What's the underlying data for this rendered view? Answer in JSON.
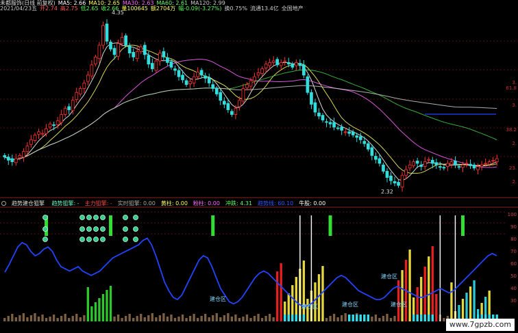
{
  "header": {
    "line1": [
      {
        "text": "未都服饰(日线 前复权)",
        "color": "#dddddd"
      },
      {
        "text": "MA5: 2.66",
        "color": "#ffffff"
      },
      {
        "text": "MA10: 2.65",
        "color": "#ffff66"
      },
      {
        "text": "MA30: 2.63",
        "color": "#ff66ff"
      },
      {
        "text": "MA60: 2.61",
        "color": "#66ff66"
      },
      {
        "text": "MA120: 2.99",
        "color": "#cccccc"
      }
    ],
    "line2": [
      {
        "text": "2021/04/23五",
        "color": "#cccccc"
      },
      {
        "text": "开2.74",
        "color": "#ff5555"
      },
      {
        "text": "高2.75",
        "color": "#ff5555"
      },
      {
        "text": "低2.65",
        "color": "#55ff55"
      },
      {
        "text": "收2.66",
        "color": "#55ff55"
      },
      {
        "text": "量100645",
        "color": "#ffff66"
      },
      {
        "text": "额2704万",
        "color": "#ffff66"
      },
      {
        "text": "幅-0.09(-3.27%)",
        "color": "#55ff55"
      },
      {
        "text": "换0.75%",
        "color": "#cccccc"
      },
      {
        "text": "流通13.4亿",
        "color": "#cccccc"
      },
      {
        "text": "全国地产",
        "color": "#cccccc"
      }
    ]
  },
  "price_axis": {
    "ticks": [
      "3.",
      "61.8",
      "3.",
      "38.2",
      "2.",
      "23.",
      "2."
    ]
  },
  "annotations": {
    "high": "4.35",
    "low": "2.32"
  },
  "indicator_header": {
    "title": "趋势建仓狙擎",
    "items": [
      {
        "text": "趋势狙擎: -",
        "color": "#66ffcc"
      },
      {
        "text": "主力狙擎: -",
        "color": "#ff4444"
      },
      {
        "text": "实时狙擎: 0.00",
        "color": "#aaaaaa"
      },
      {
        "text": "黄柱: 0.00",
        "color": "#ffff66"
      },
      {
        "text": "粉柱: 0.00",
        "color": "#ff66ff"
      },
      {
        "text": "冲跌: 4.31",
        "color": "#66ff66"
      },
      {
        "text": "趋势线: 60.10",
        "color": "#3355ff"
      },
      {
        "text": "牛股: 0.00",
        "color": "#ffffff"
      }
    ]
  },
  "indicator_axis": {
    "ticks": [
      "100",
      "90",
      "80",
      "70",
      "60",
      "50",
      "40",
      "30"
    ]
  },
  "indicator_labels": [
    "建仓区",
    "建仓区",
    "建仓区",
    "建仓区",
    "建仓区"
  ],
  "watermark": "www.7gpzb.com",
  "colors": {
    "up": "#ff3333",
    "down": "#33dddd",
    "ma5": "#ffffff",
    "ma10": "#ffff66",
    "ma30": "#ff66ff",
    "ma60": "#44cc44",
    "ma120": "#cccccc",
    "trend": "#2244ff",
    "green_bar": "#33dd33",
    "yellow_bar": "#ffee44",
    "red_bar": "#ff2222",
    "cyan_bar": "#33ddee"
  },
  "chart_data": [
    {
      "type": "candlestick",
      "title": "未都服饰(日线 前复权)",
      "ylim": [
        2.2,
        4.5
      ],
      "closes": [
        2.68,
        2.64,
        2.62,
        2.66,
        2.7,
        2.75,
        2.82,
        2.9,
        2.96,
        3.0,
        2.98,
        3.04,
        3.1,
        3.08,
        3.14,
        3.22,
        3.3,
        3.28,
        3.4,
        3.5,
        3.55,
        3.62,
        3.72,
        3.85,
        3.95,
        4.1,
        4.35,
        4.15,
        4.05,
        3.98,
        4.12,
        4.2,
        4.1,
        4.0,
        3.95,
        4.02,
        4.08,
        3.98,
        3.86,
        3.8,
        3.9,
        4.0,
        3.95,
        3.88,
        3.82,
        3.78,
        3.7,
        3.66,
        3.6,
        3.64,
        3.7,
        3.76,
        3.72,
        3.68,
        3.62,
        3.55,
        3.48,
        3.4,
        3.35,
        3.28,
        3.22,
        3.3,
        3.4,
        3.55,
        3.6,
        3.65,
        3.7,
        3.75,
        3.8,
        3.86,
        3.88,
        3.9,
        3.85,
        3.88,
        3.9,
        3.86,
        3.82,
        3.88,
        3.84,
        3.72,
        3.5,
        3.35,
        3.25,
        3.2,
        3.15,
        3.12,
        3.1,
        3.06,
        3.05,
        3.02,
        3.0,
        2.98,
        2.96,
        2.93,
        2.9,
        2.85,
        2.78,
        2.7,
        2.65,
        2.6,
        2.5,
        2.42,
        2.38,
        2.35,
        2.32,
        2.45,
        2.52,
        2.58,
        2.62,
        2.6,
        2.56,
        2.62,
        2.65,
        2.6,
        2.58,
        2.55,
        2.54,
        2.6,
        2.62,
        2.58,
        2.55,
        2.58,
        2.6,
        2.57,
        2.54,
        2.56,
        2.58,
        2.6,
        2.62,
        2.64,
        2.66
      ],
      "series": [
        {
          "name": "MA5",
          "last": 2.66
        },
        {
          "name": "MA10",
          "last": 2.65
        },
        {
          "name": "MA30",
          "last": 2.63
        },
        {
          "name": "MA60",
          "last": 2.61
        },
        {
          "name": "MA120",
          "last": 2.99
        }
      ]
    },
    {
      "type": "bar",
      "title": "趋势建仓狙擎",
      "ylim": [
        0,
        100
      ],
      "trend_line": [
        45,
        52,
        60,
        68,
        72,
        70,
        64,
        60,
        62,
        66,
        68,
        64,
        56,
        50,
        48,
        46,
        48,
        50,
        46,
        44,
        42,
        44,
        46,
        50,
        54,
        58,
        60,
        62,
        64,
        66,
        68,
        70,
        74,
        76,
        70,
        60,
        48,
        36,
        28,
        22,
        20,
        24,
        32,
        40,
        48,
        56,
        60,
        58,
        50,
        40,
        30,
        24,
        18,
        16,
        18,
        22,
        28,
        34,
        40,
        44,
        46,
        44,
        40,
        36,
        32,
        28,
        24,
        20,
        16,
        14,
        14,
        16,
        20,
        24,
        28,
        32,
        36,
        40,
        42,
        40,
        36,
        32,
        28,
        26,
        24,
        22,
        20,
        20,
        22,
        26,
        30,
        32,
        30,
        28,
        26,
        24,
        22,
        22,
        24,
        26,
        28,
        30,
        28,
        26,
        28,
        32,
        36,
        40,
        44,
        48,
        52,
        56,
        60,
        62,
        60
      ],
      "green_signal_columns": [
        11,
        28,
        55,
        86,
        121,
        150
      ],
      "tall_columns": [
        78,
        81,
        115,
        119,
        142,
        146
      ]
    }
  ]
}
